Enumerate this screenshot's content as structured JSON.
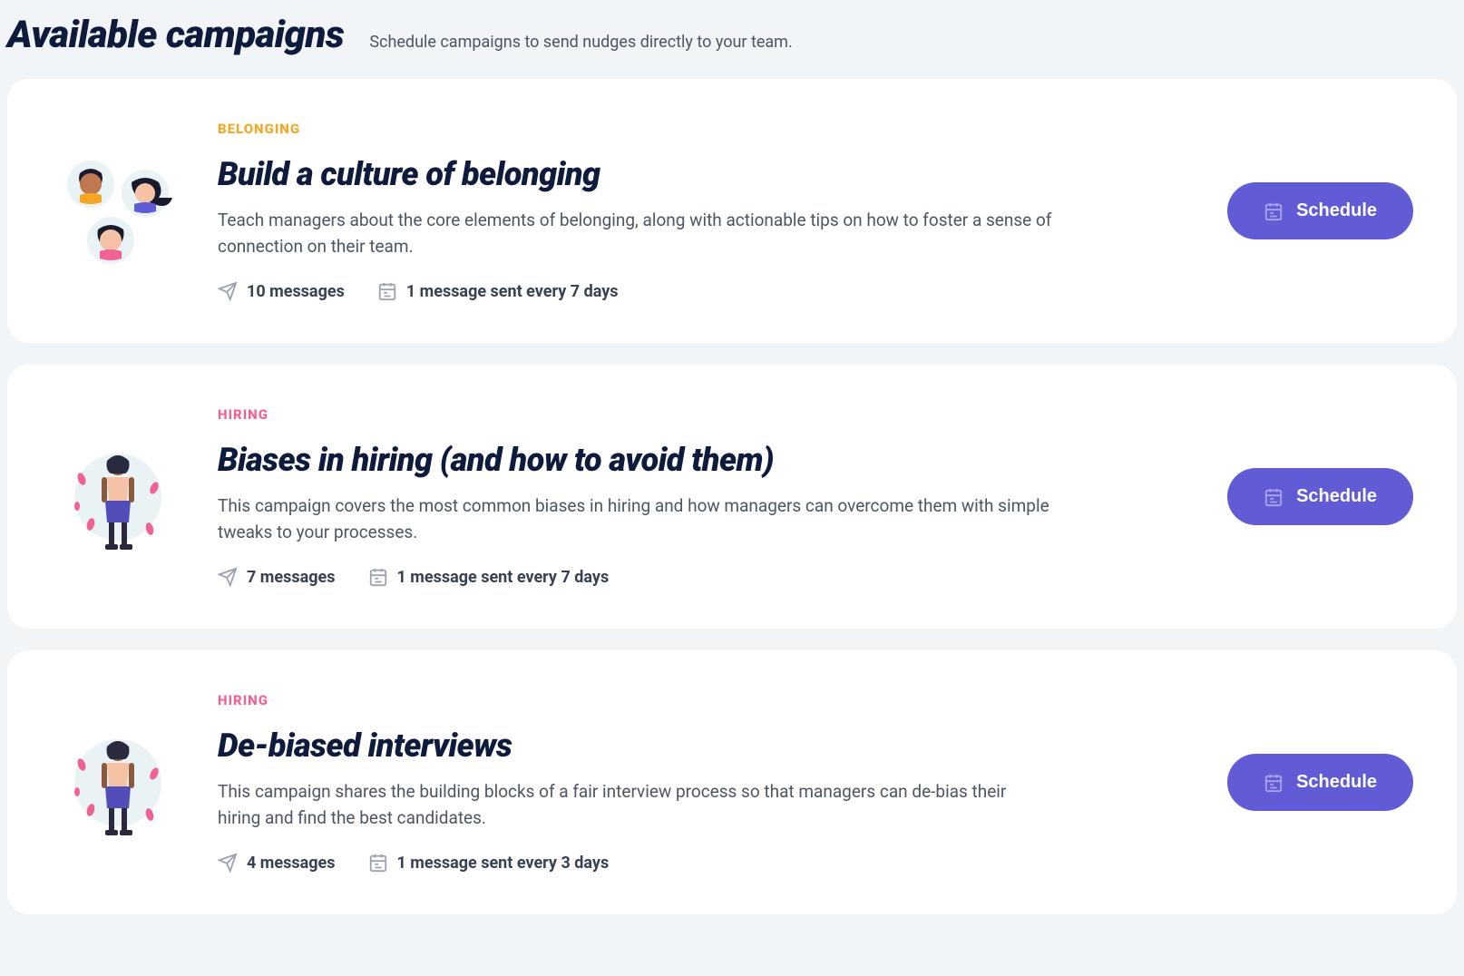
{
  "header": {
    "title": "Available campaigns",
    "subtitle": "Schedule campaigns to send nudges directly to your team."
  },
  "scheduleButtonLabel": "Schedule",
  "campaigns": [
    {
      "category": "BELONGING",
      "categoryClass": "cat-belonging",
      "title": "Build a culture of belonging",
      "description": "Teach managers about the core elements of belonging, along with actionable tips on how to foster a sense of connection on their team.",
      "messages": "10 messages",
      "frequency": "1 message sent every 7 days",
      "icon": "people-group"
    },
    {
      "category": "HIRING",
      "categoryClass": "cat-hiring",
      "title": "Biases in hiring (and how to avoid them)",
      "description": "This campaign covers the most common biases in hiring and how managers can overcome them with simple tweaks to your processes.",
      "messages": "7 messages",
      "frequency": "1 message sent every 7 days",
      "icon": "person-standing"
    },
    {
      "category": "HIRING",
      "categoryClass": "cat-hiring",
      "title": "De-biased interviews",
      "description": "This campaign shares the building blocks of a fair interview process so that managers can de-bias their hiring and find the best candidates.",
      "messages": "4 messages",
      "frequency": "1 message sent every 3 days",
      "icon": "person-standing"
    }
  ]
}
